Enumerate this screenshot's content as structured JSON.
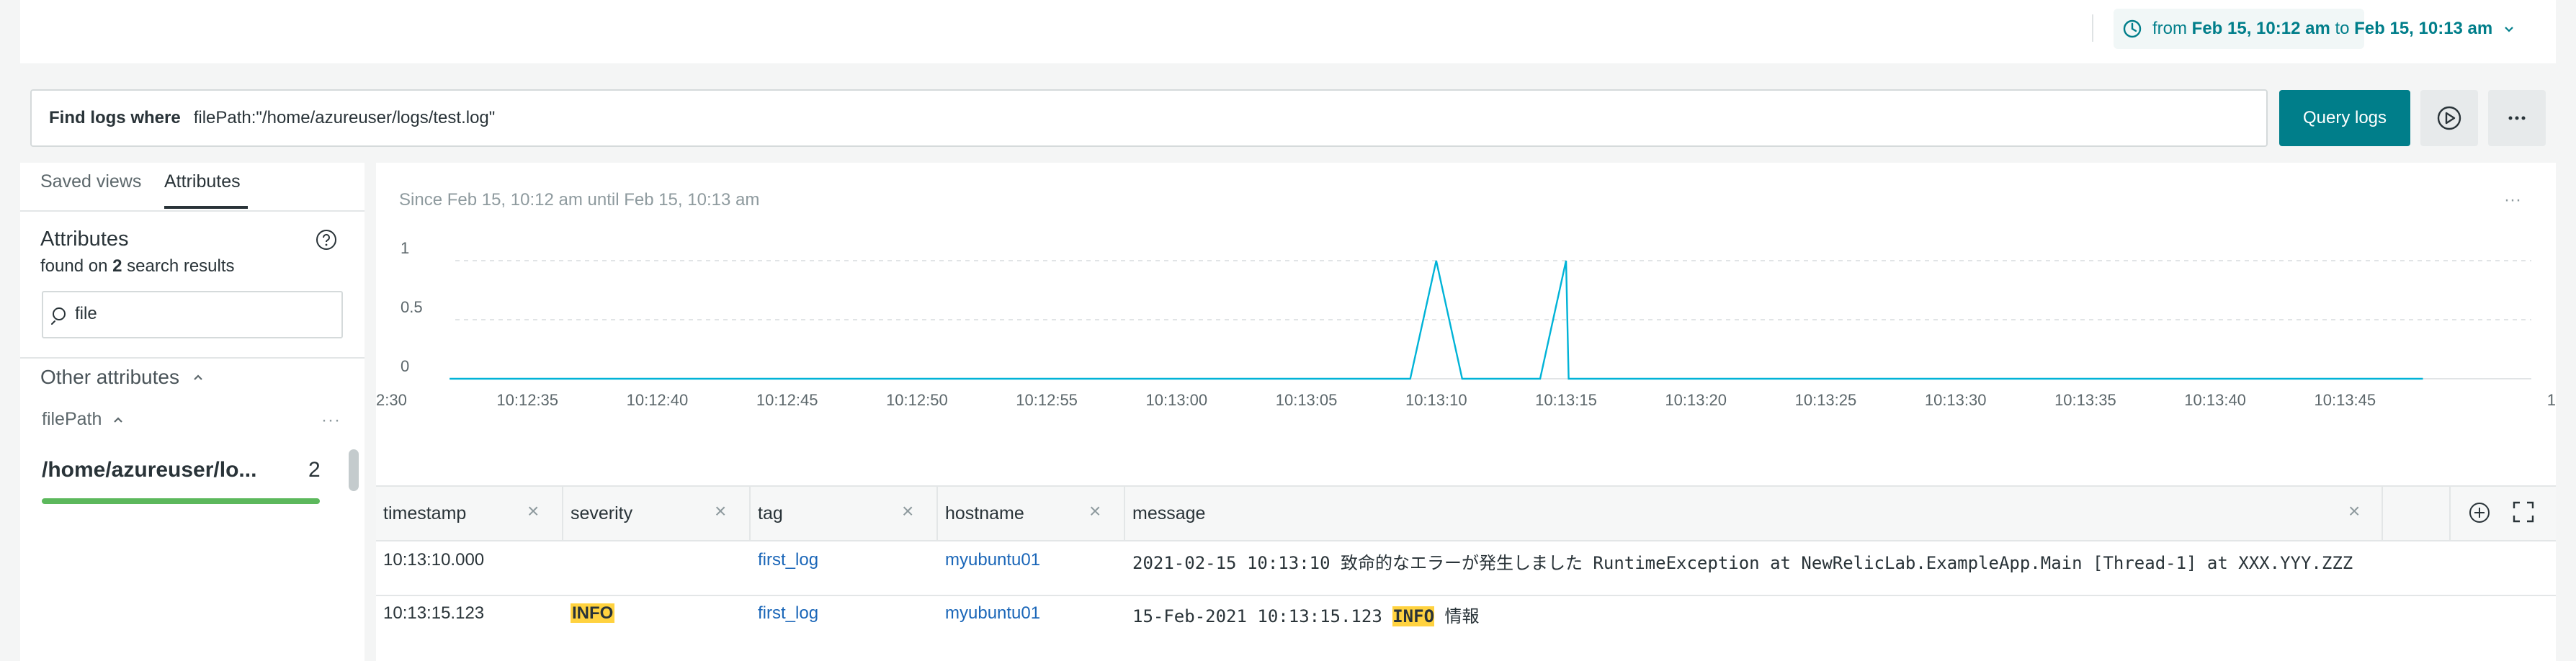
{
  "time_picker": {
    "from_word": "from",
    "from_value": "Feb 15, 10:12 am",
    "to_word": "to",
    "to_value": "Feb 15, 10:13 am"
  },
  "query": {
    "label": "Find logs where",
    "value": "filePath:\"/home/azureuser/logs/test.log\"",
    "button": "Query logs"
  },
  "left_panel": {
    "tabs": [
      "Saved views",
      "Attributes"
    ],
    "active_tab": "Attributes",
    "heading": "Attributes",
    "found_prefix": "found on",
    "found_count": "2",
    "found_suffix": "search results",
    "search_value": "file",
    "section": "Other attributes",
    "attribute_name": "filePath",
    "attribute_value": "/home/azureuser/lo...",
    "attribute_count": "2",
    "attribute_fraction": 1.0
  },
  "chart_card": {
    "since": "Since Feb 15, 10:12 am until Feb 15, 10:13 am",
    "more": "···"
  },
  "chart_data": {
    "type": "line",
    "yticks": [
      "1",
      "0.5",
      "0"
    ],
    "ylim": [
      0,
      1
    ],
    "xticks": [
      ":2:30",
      "10:12:35",
      "10:12:40",
      "10:12:45",
      "10:12:50",
      "10:12:55",
      "10:13:00",
      "10:13:05",
      "10:13:10",
      "10:13:15",
      "10:13:20",
      "10:13:25",
      "10:13:30",
      "10:13:35",
      "10:13:40",
      "10:13:45",
      "1"
    ],
    "x_start_label": "2:30",
    "series": [
      {
        "color": "#00b3d7",
        "points": [
          [
            "10:12:32",
            0
          ],
          [
            "10:13:09",
            0
          ],
          [
            "10:13:10",
            1
          ],
          [
            "10:13:11",
            0
          ],
          [
            "10:13:14",
            0
          ],
          [
            "10:13:15",
            1
          ],
          [
            "10:13:15.1",
            0
          ],
          [
            "10:13:48",
            0
          ]
        ]
      }
    ],
    "grid": "dashed-horizontal"
  },
  "table": {
    "columns": [
      "timestamp",
      "severity",
      "tag",
      "hostname",
      "message"
    ],
    "rows": [
      {
        "timestamp": "10:13:10.000",
        "severity": "",
        "tag": "first_log",
        "hostname": "myubuntu01",
        "message": "2021-02-15 10:13:10 致命的なエラーが発生しました RuntimeException at NewRelicLab.ExampleApp.Main [Thread-1] at XXX.YYY.ZZZ"
      },
      {
        "timestamp": "10:13:15.123",
        "severity": "INFO",
        "tag": "first_log",
        "hostname": "myubuntu01",
        "message_prefix": "15-Feb-2021 10:13:15.123 ",
        "message_highlight": "INFO",
        "message_suffix": " 情報"
      }
    ]
  }
}
